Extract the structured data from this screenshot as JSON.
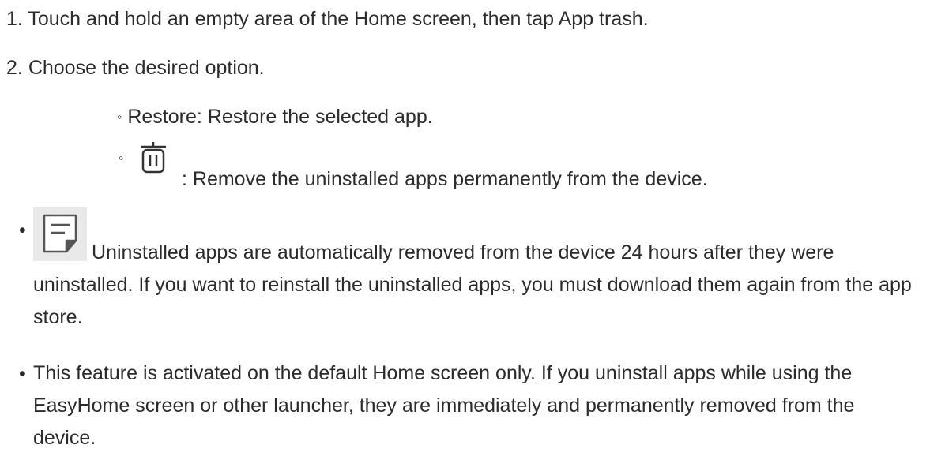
{
  "steps": [
    {
      "number": "1.",
      "text": "Touch and hold an empty area of the Home screen, then tap App trash."
    },
    {
      "number": "2.",
      "text": "Choose the desired option."
    }
  ],
  "options": [
    {
      "marker": "◦",
      "text": "Restore: Restore the selected app."
    },
    {
      "marker": "◦",
      "icon": "trash-icon",
      "text": ": Remove the uninstalled apps permanently from the device."
    }
  ],
  "notes": [
    {
      "marker": "•",
      "icon": "note-icon",
      "text": "Uninstalled apps are automatically removed from the device 24 hours after they were uninstalled. If you want to reinstall the uninstalled apps, you must download them again from the app store."
    },
    {
      "marker": "•",
      "text": "This feature is activated on the default Home screen only. If you uninstall apps while using the EasyHome screen or other launcher, they are immediately and permanently removed from the device."
    }
  ]
}
